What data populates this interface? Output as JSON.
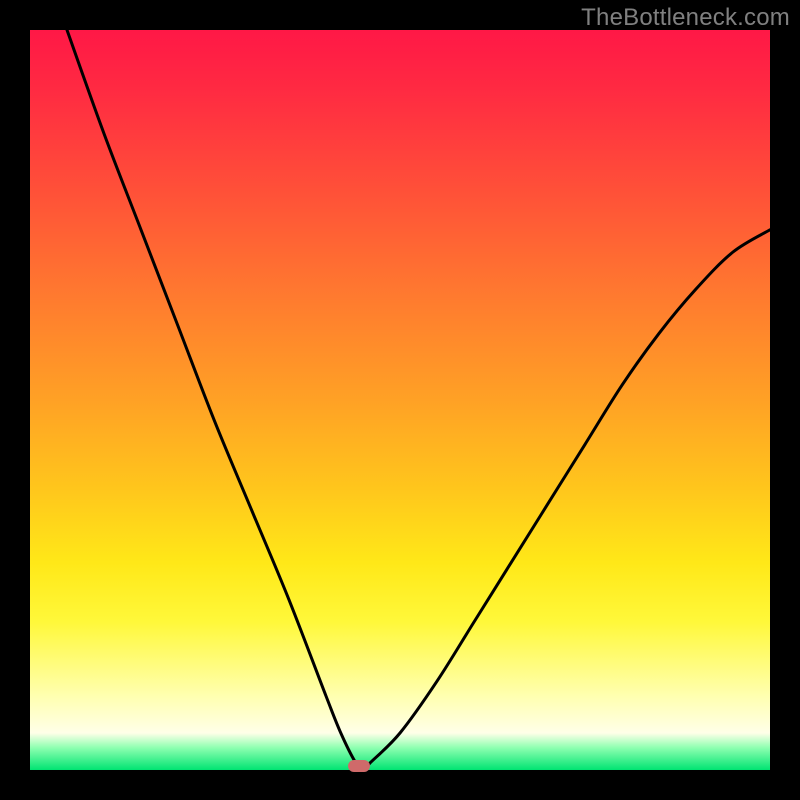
{
  "watermark": "TheBottleneck.com",
  "chart_data": {
    "type": "line",
    "title": "",
    "xlabel": "",
    "ylabel": "",
    "xlim": [
      0,
      100
    ],
    "ylim": [
      0,
      100
    ],
    "grid": false,
    "legend": false,
    "series": [
      {
        "name": "bottleneck-curve",
        "x": [
          5,
          10,
          15,
          20,
          25,
          30,
          35,
          40,
          42,
          44,
          45,
          46,
          50,
          55,
          60,
          65,
          70,
          75,
          80,
          85,
          90,
          95,
          100
        ],
        "y": [
          100,
          86,
          73,
          60,
          47,
          35,
          23,
          10,
          5,
          1,
          0,
          1,
          5,
          12,
          20,
          28,
          36,
          44,
          52,
          59,
          65,
          70,
          73
        ]
      }
    ],
    "annotations": [
      {
        "name": "optimal-marker",
        "x": 44.5,
        "y": 0.5,
        "color": "#cf6a6a"
      }
    ],
    "background_gradient": {
      "direction": "vertical",
      "stops": [
        {
          "pos": 0.0,
          "color": "#ff1846"
        },
        {
          "pos": 0.5,
          "color": "#ffa125"
        },
        {
          "pos": 0.8,
          "color": "#fff83a"
        },
        {
          "pos": 0.95,
          "color": "#ffffe8"
        },
        {
          "pos": 1.0,
          "color": "#00e472"
        }
      ]
    }
  }
}
